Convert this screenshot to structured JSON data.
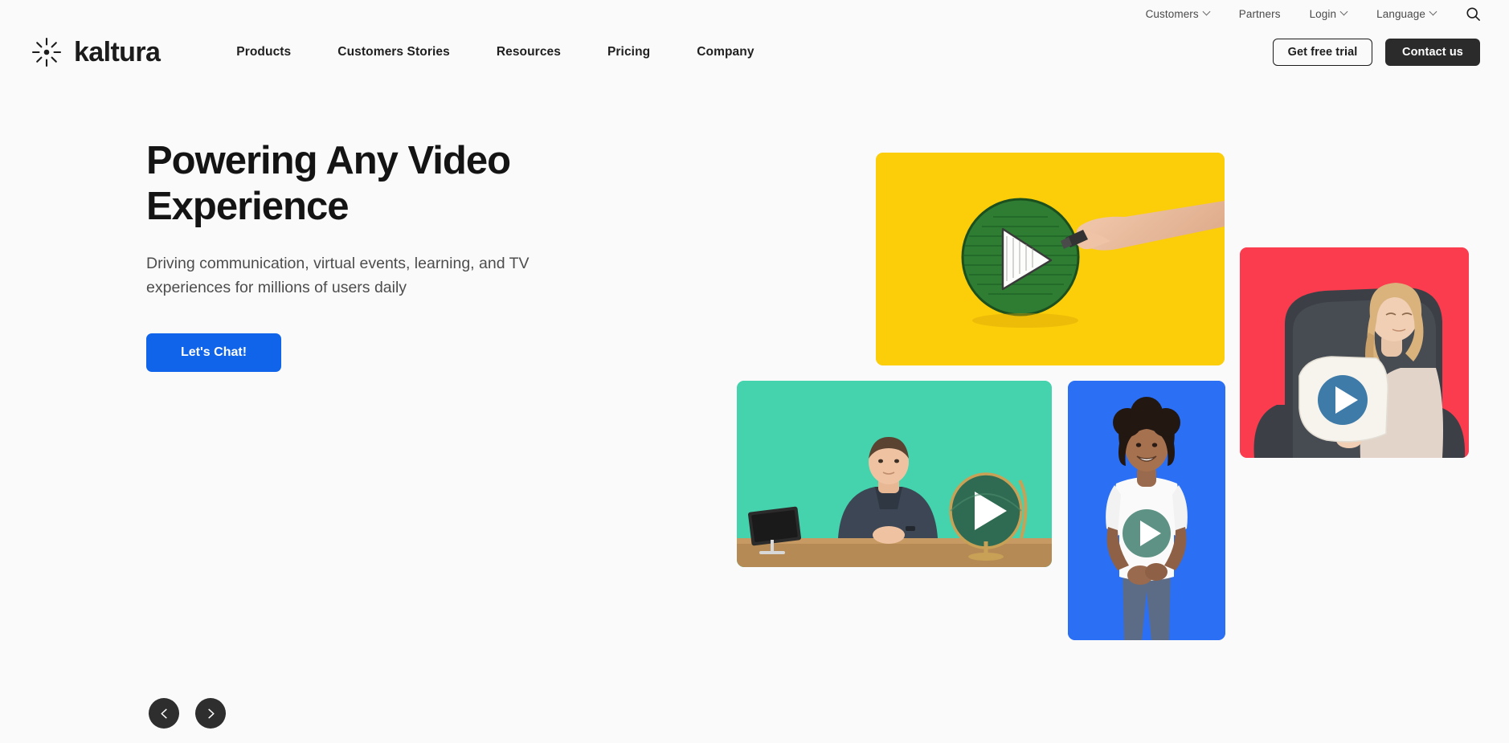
{
  "topnav": {
    "items": [
      {
        "label": "Customers",
        "has_caret": true
      },
      {
        "label": "Partners",
        "has_caret": false
      },
      {
        "label": "Login",
        "has_caret": true
      },
      {
        "label": "Language",
        "has_caret": true
      }
    ],
    "search_icon": "search-icon"
  },
  "brand": {
    "name": "kaltura",
    "logo_icon": "kaltura-starburst-logo"
  },
  "mainnav": {
    "items": [
      {
        "label": "Products"
      },
      {
        "label": "Customers Stories"
      },
      {
        "label": "Resources"
      },
      {
        "label": "Pricing"
      },
      {
        "label": "Company"
      }
    ]
  },
  "header_cta": {
    "free_trial_label": "Get free trial",
    "contact_label": "Contact us"
  },
  "hero": {
    "title": "Powering Any Video Experience",
    "subtitle": "Driving communication, virtual events, learning, and TV experiences for millions of users daily",
    "cta_label": "Let's Chat!",
    "cta_color": "#1064EA"
  },
  "carousel": {
    "prev_icon": "chevron-left-icon",
    "next_icon": "chevron-right-icon"
  },
  "collage": {
    "cards": [
      {
        "name": "yellow-card",
        "color": "#FCCD09",
        "description": "Hand drawing a green scribbled circle with white play triangle"
      },
      {
        "name": "teal-card",
        "color": "#44D3AC",
        "description": "Man seated at desk with tablet and green globe bearing white play triangle"
      },
      {
        "name": "blue-card",
        "color": "#2B6FF5",
        "description": "Smiling woman in white t-shirt with teal play button circle"
      },
      {
        "name": "red-card",
        "color": "#FA3C4E",
        "description": "Woman in dark armchair holding white pillow with blue play button"
      }
    ]
  },
  "theme": {
    "background": "#FAFAFA",
    "text_dark": "#141414",
    "dark_button": "#2B2B2B"
  }
}
